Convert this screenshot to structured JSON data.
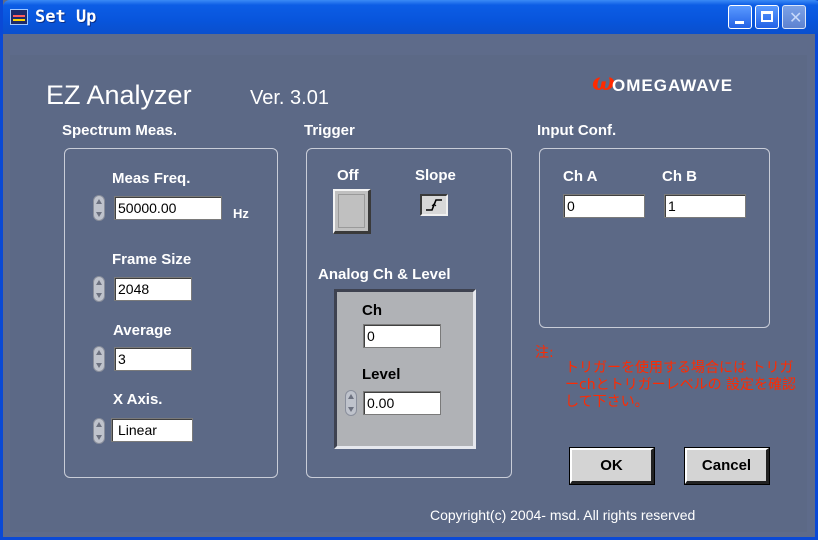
{
  "window": {
    "title": "Set Up",
    "controls": {
      "minimize": "minimize-icon",
      "maximize": "maximize-icon",
      "close": "close-icon"
    }
  },
  "header": {
    "app_name": "EZ Analyzer",
    "version": "Ver.  3.01",
    "logo_mark": "ω",
    "logo_text": "OMEGAWAVE"
  },
  "spectrum": {
    "title": "Spectrum Meas.",
    "meas_freq": {
      "label": "Meas Freq.",
      "value": "50000.00",
      "unit": "Hz"
    },
    "frame_size": {
      "label": "Frame Size",
      "value": "2048"
    },
    "average": {
      "label": "Average",
      "value": "3"
    },
    "x_axis": {
      "label": "X Axis.",
      "value": "Linear"
    }
  },
  "trigger": {
    "title": "Trigger",
    "off_label": "Off",
    "slope_label": "Slope",
    "analog_title": "Analog Ch & Level",
    "ch": {
      "label": "Ch",
      "value": "0"
    },
    "level": {
      "label": "Level",
      "value": "0.00"
    }
  },
  "input_conf": {
    "title": "Input Conf.",
    "ch_a": {
      "label": "Ch A",
      "value": "0"
    },
    "ch_b": {
      "label": "Ch B",
      "value": "1"
    }
  },
  "note": {
    "head": "注:",
    "body": "トリガーを使用する場合には トリガーchとトリガーレベルの 設定を確認して下さい。"
  },
  "buttons": {
    "ok": "OK",
    "cancel": "Cancel"
  },
  "footer": {
    "copyright": "Copyright(c) 2004- msd.  All rights reserved"
  },
  "colors": {
    "background": "#5c6986",
    "titlebar": "#0855dc",
    "note": "#ff2a00",
    "logo": "#ff2a00"
  }
}
